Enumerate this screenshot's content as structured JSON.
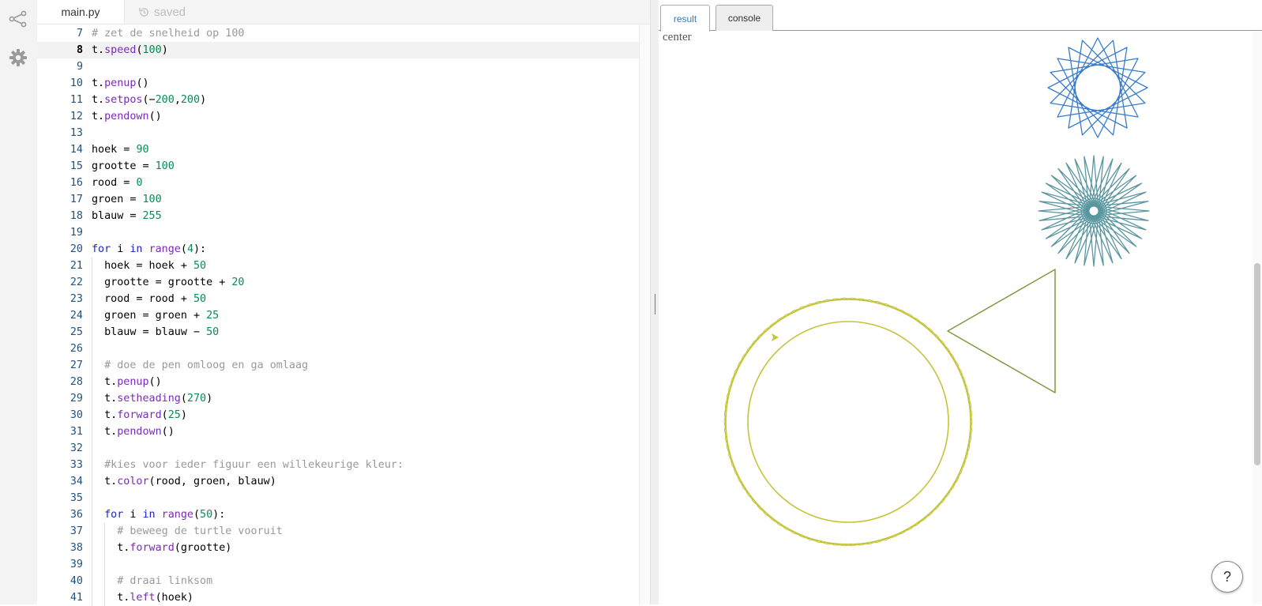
{
  "editor": {
    "file_tab": "main.py",
    "save_status": "saved",
    "active_line": 8,
    "lines": [
      {
        "n": "7",
        "indent": 0,
        "tokens": [
          [
            "c",
            "# zet de snelheid op 100"
          ]
        ]
      },
      {
        "n": "8",
        "indent": 0,
        "tokens": [
          [
            "t",
            "t."
          ],
          [
            "f",
            "speed"
          ],
          [
            "t",
            "("
          ],
          [
            "n",
            "100"
          ],
          [
            "t",
            ")"
          ]
        ]
      },
      {
        "n": "9",
        "indent": 0,
        "tokens": []
      },
      {
        "n": "10",
        "indent": 0,
        "tokens": [
          [
            "t",
            "t."
          ],
          [
            "f",
            "penup"
          ],
          [
            "t",
            "()"
          ]
        ]
      },
      {
        "n": "11",
        "indent": 0,
        "tokens": [
          [
            "t",
            "t."
          ],
          [
            "f",
            "setpos"
          ],
          [
            "t",
            "(−"
          ],
          [
            "n",
            "200"
          ],
          [
            "t",
            ","
          ],
          [
            "n",
            "200"
          ],
          [
            "t",
            ")"
          ]
        ]
      },
      {
        "n": "12",
        "indent": 0,
        "tokens": [
          [
            "t",
            "t."
          ],
          [
            "f",
            "pendown"
          ],
          [
            "t",
            "()"
          ]
        ]
      },
      {
        "n": "13",
        "indent": 0,
        "tokens": []
      },
      {
        "n": "14",
        "indent": 0,
        "tokens": [
          [
            "t",
            "hoek = "
          ],
          [
            "n",
            "90"
          ]
        ]
      },
      {
        "n": "15",
        "indent": 0,
        "tokens": [
          [
            "t",
            "grootte = "
          ],
          [
            "n",
            "100"
          ]
        ]
      },
      {
        "n": "16",
        "indent": 0,
        "tokens": [
          [
            "t",
            "rood = "
          ],
          [
            "n",
            "0"
          ]
        ]
      },
      {
        "n": "17",
        "indent": 0,
        "tokens": [
          [
            "t",
            "groen = "
          ],
          [
            "n",
            "100"
          ]
        ]
      },
      {
        "n": "18",
        "indent": 0,
        "tokens": [
          [
            "t",
            "blauw = "
          ],
          [
            "n",
            "255"
          ]
        ]
      },
      {
        "n": "19",
        "indent": 0,
        "tokens": []
      },
      {
        "n": "20",
        "indent": 0,
        "tokens": [
          [
            "k",
            "for"
          ],
          [
            "t",
            " i "
          ],
          [
            "k",
            "in"
          ],
          [
            "t",
            " "
          ],
          [
            "f",
            "range"
          ],
          [
            "t",
            "("
          ],
          [
            "n",
            "4"
          ],
          [
            "t",
            "):"
          ]
        ]
      },
      {
        "n": "21",
        "indent": 1,
        "tokens": [
          [
            "t",
            "hoek = hoek + "
          ],
          [
            "n",
            "50"
          ]
        ]
      },
      {
        "n": "22",
        "indent": 1,
        "tokens": [
          [
            "t",
            "grootte = grootte + "
          ],
          [
            "n",
            "20"
          ]
        ]
      },
      {
        "n": "23",
        "indent": 1,
        "tokens": [
          [
            "t",
            "rood = rood + "
          ],
          [
            "n",
            "50"
          ]
        ]
      },
      {
        "n": "24",
        "indent": 1,
        "tokens": [
          [
            "t",
            "groen = groen + "
          ],
          [
            "n",
            "25"
          ]
        ]
      },
      {
        "n": "25",
        "indent": 1,
        "tokens": [
          [
            "t",
            "blauw = blauw − "
          ],
          [
            "n",
            "50"
          ]
        ]
      },
      {
        "n": "26",
        "indent": 1,
        "tokens": []
      },
      {
        "n": "27",
        "indent": 1,
        "tokens": [
          [
            "c",
            "# doe de pen omloog en ga omlaag"
          ]
        ]
      },
      {
        "n": "28",
        "indent": 1,
        "tokens": [
          [
            "t",
            "t."
          ],
          [
            "f",
            "penup"
          ],
          [
            "t",
            "()"
          ]
        ]
      },
      {
        "n": "29",
        "indent": 1,
        "tokens": [
          [
            "t",
            "t."
          ],
          [
            "f",
            "setheading"
          ],
          [
            "t",
            "("
          ],
          [
            "n",
            "270"
          ],
          [
            "t",
            ")"
          ]
        ]
      },
      {
        "n": "30",
        "indent": 1,
        "tokens": [
          [
            "t",
            "t."
          ],
          [
            "f",
            "forward"
          ],
          [
            "t",
            "("
          ],
          [
            "n",
            "25"
          ],
          [
            "t",
            ")"
          ]
        ]
      },
      {
        "n": "31",
        "indent": 1,
        "tokens": [
          [
            "t",
            "t."
          ],
          [
            "f",
            "pendown"
          ],
          [
            "t",
            "()"
          ]
        ]
      },
      {
        "n": "32",
        "indent": 1,
        "tokens": []
      },
      {
        "n": "33",
        "indent": 1,
        "tokens": [
          [
            "c",
            "#kies voor ieder figuur een willekeurige kleur:"
          ]
        ]
      },
      {
        "n": "34",
        "indent": 1,
        "tokens": [
          [
            "t",
            "t."
          ],
          [
            "f",
            "color"
          ],
          [
            "t",
            "(rood, groen, blauw)"
          ]
        ]
      },
      {
        "n": "35",
        "indent": 1,
        "tokens": []
      },
      {
        "n": "36",
        "indent": 1,
        "tokens": [
          [
            "k",
            "for"
          ],
          [
            "t",
            " i "
          ],
          [
            "k",
            "in"
          ],
          [
            "t",
            " "
          ],
          [
            "f",
            "range"
          ],
          [
            "t",
            "("
          ],
          [
            "n",
            "50"
          ],
          [
            "t",
            "):"
          ]
        ]
      },
      {
        "n": "37",
        "indent": 2,
        "tokens": [
          [
            "c",
            "# beweeg de turtle vooruit"
          ]
        ]
      },
      {
        "n": "38",
        "indent": 2,
        "tokens": [
          [
            "t",
            "t."
          ],
          [
            "f",
            "forward"
          ],
          [
            "t",
            "(grootte)"
          ]
        ]
      },
      {
        "n": "39",
        "indent": 2,
        "tokens": []
      },
      {
        "n": "40",
        "indent": 2,
        "tokens": [
          [
            "c",
            "# draai linksom"
          ]
        ]
      },
      {
        "n": "41",
        "indent": 2,
        "tokens": [
          [
            "t",
            "t."
          ],
          [
            "f",
            "left"
          ],
          [
            "t",
            "(hoek)"
          ]
        ]
      }
    ]
  },
  "output": {
    "tabs": [
      "result",
      "console"
    ],
    "active_tab": "result",
    "canvas_label": "center",
    "help_label": "?",
    "figures": {
      "star20_color": "#3a7bcc",
      "star36_color": "#5a96a0",
      "triangle_color": "#7b9c3e",
      "polygons_color": "#c4c43a"
    }
  },
  "rail": {
    "icons": [
      "share-icon",
      "gear-icon"
    ]
  }
}
